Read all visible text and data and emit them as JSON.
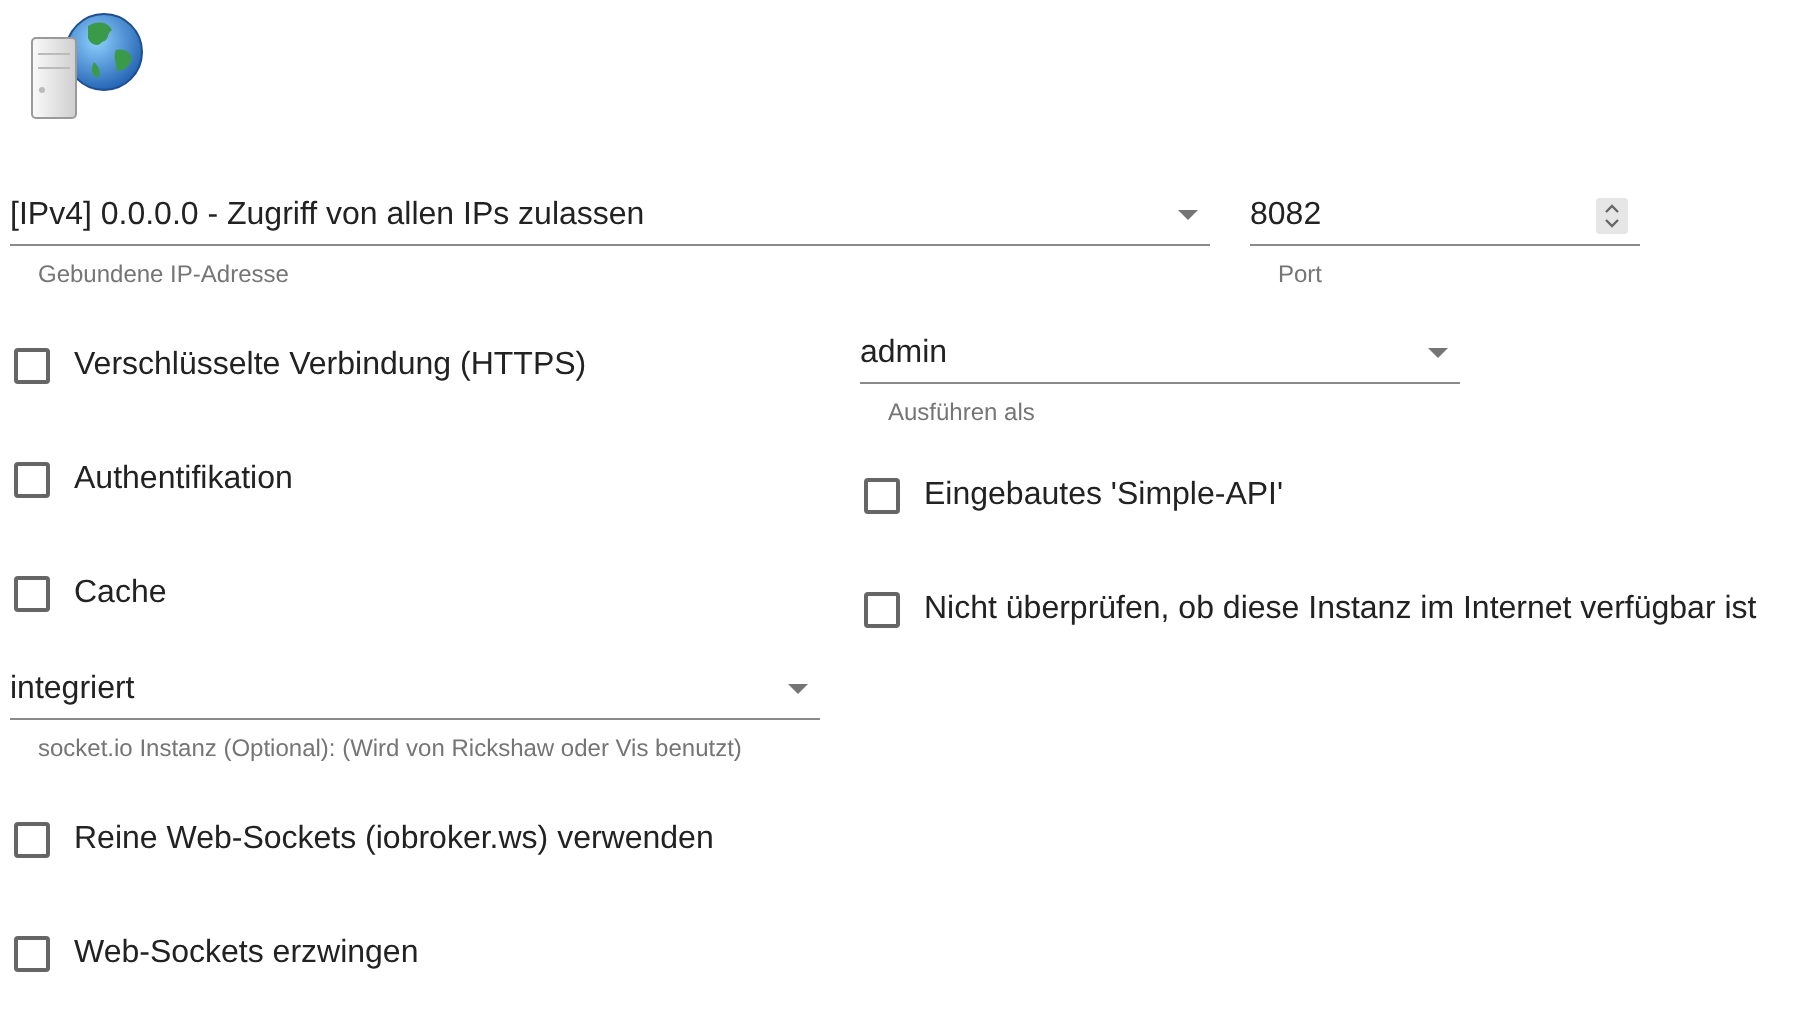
{
  "bind_address": {
    "value": "[IPv4] 0.0.0.0 - Zugriff von allen IPs zulassen",
    "helper": "Gebundene IP-Adresse"
  },
  "port": {
    "value": "8082",
    "helper": "Port"
  },
  "left_column": [
    {
      "kind": "checkbox",
      "label": "Verschlüsselte Verbindung (HTTPS)",
      "checked": false
    },
    {
      "kind": "checkbox",
      "label": "Authentifikation",
      "checked": false
    },
    {
      "kind": "checkbox",
      "label": "Cache",
      "checked": false
    },
    {
      "kind": "select",
      "value": "integriert",
      "helper": "socket.io Instanz (Optional): (Wird von Rickshaw oder Vis benutzt)"
    },
    {
      "kind": "checkbox",
      "label": "Reine Web-Sockets (iobroker.ws) verwenden",
      "checked": false
    },
    {
      "kind": "checkbox",
      "label": "Web-Sockets erzwingen",
      "checked": false
    }
  ],
  "right_column": [
    {
      "kind": "select",
      "value": "admin",
      "helper": "Ausführen als"
    },
    {
      "kind": "checkbox",
      "label": "Eingebautes 'Simple-API'",
      "checked": false
    },
    {
      "kind": "checkbox",
      "label": "Nicht überprüfen, ob diese Instanz im Internet verfügbar ist",
      "checked": false
    }
  ]
}
